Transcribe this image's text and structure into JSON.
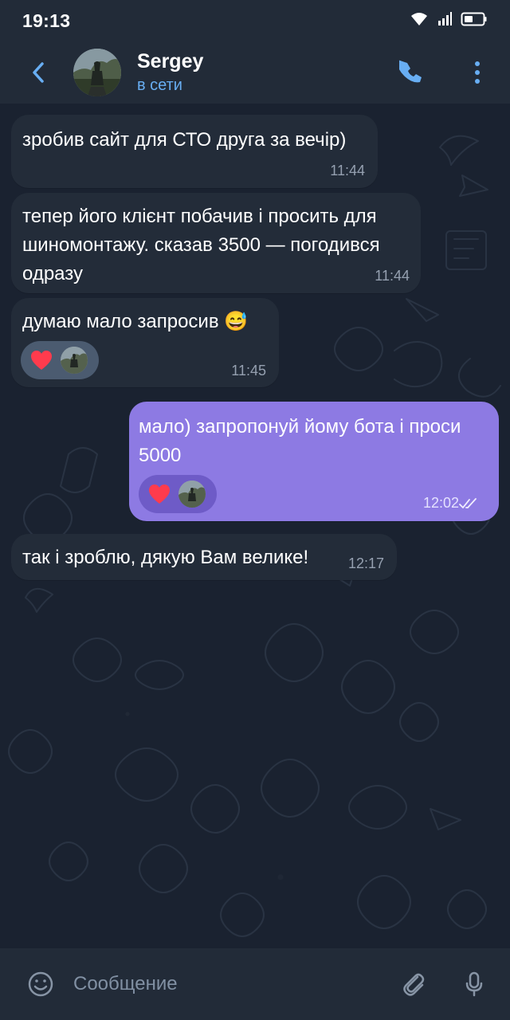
{
  "status_bar": {
    "time": "19:13"
  },
  "header": {
    "name": "Sergey",
    "status": "в сети",
    "icons": {
      "back": "back-arrow-icon",
      "call": "phone-icon",
      "more": "more-vert-icon"
    }
  },
  "messages": [
    {
      "direction": "incoming",
      "text": "зробив сайт для СТО друга за вечір)",
      "time": "11:44"
    },
    {
      "direction": "incoming",
      "text": "тепер його клієнт побачив і просить для шиномонтажу. сказав 3500 — погодився одразу",
      "time": "11:44"
    },
    {
      "direction": "incoming",
      "text": "думаю мало запросив 😅",
      "time": "11:45",
      "reaction": "❤️"
    },
    {
      "direction": "outgoing",
      "text": "мало) запропонуй йому бота і проси 5000",
      "time": "12:02",
      "reaction": "❤️",
      "read_status": "double-check-icon"
    },
    {
      "direction": "incoming",
      "text": "так і зроблю, дякую Вам велике!",
      "time": "12:17"
    }
  ],
  "input": {
    "placeholder": "Сообщение",
    "icons": {
      "emoji": "emoji-icon",
      "attach": "paperclip-icon",
      "mic": "microphone-icon"
    }
  },
  "colors": {
    "background": "#1a2230",
    "header": "#222b38",
    "incoming_bubble": "#232c39",
    "outgoing_bubble": "#8d7ae3",
    "accent": "#68aef3"
  }
}
